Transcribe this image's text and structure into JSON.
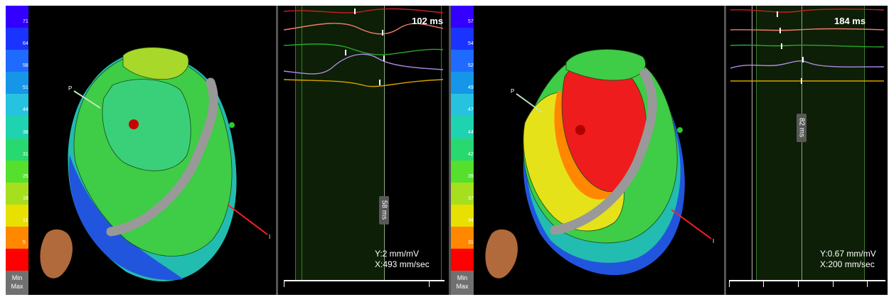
{
  "left_panel": {
    "colorbar": {
      "labels": [
        "71",
        "64",
        "58",
        "51",
        "44",
        "38",
        "31",
        "25",
        "18",
        "11",
        "5"
      ],
      "colors": [
        "#3300ff",
        "#1a33ff",
        "#1f6bff",
        "#1596e8",
        "#27c2e0",
        "#1fd3b0",
        "#27d96e",
        "#55e02e",
        "#a6df1e",
        "#e8e000",
        "#ff8800",
        "#ff0000"
      ]
    },
    "min_label": "Min",
    "max_label": "Max",
    "axis_p_label": "P",
    "axis_i_label": "I",
    "timing_label": "102 ms",
    "interval_label": "58 ms",
    "scale_y": "Y:2 mm/mV",
    "scale_x": "X:493 mm/sec"
  },
  "right_panel": {
    "colorbar": {
      "labels": [
        "57",
        "54",
        "52",
        "49",
        "47",
        "44",
        "42",
        "39",
        "37",
        "34",
        "31"
      ],
      "colors": [
        "#3300ff",
        "#1a33ff",
        "#1f6bff",
        "#1596e8",
        "#27c2e0",
        "#1fd3b0",
        "#27d96e",
        "#55e02e",
        "#a6df1e",
        "#e8e000",
        "#ff8800",
        "#ff0000"
      ]
    },
    "min_label": "Min",
    "max_label": "Max",
    "axis_p_label": "P",
    "axis_i_label": "I",
    "timing_label": "184 ms",
    "interval_label": "82 ms",
    "scale_y": "Y:0.67 mm/mV",
    "scale_x": "X:200 mm/sec"
  }
}
